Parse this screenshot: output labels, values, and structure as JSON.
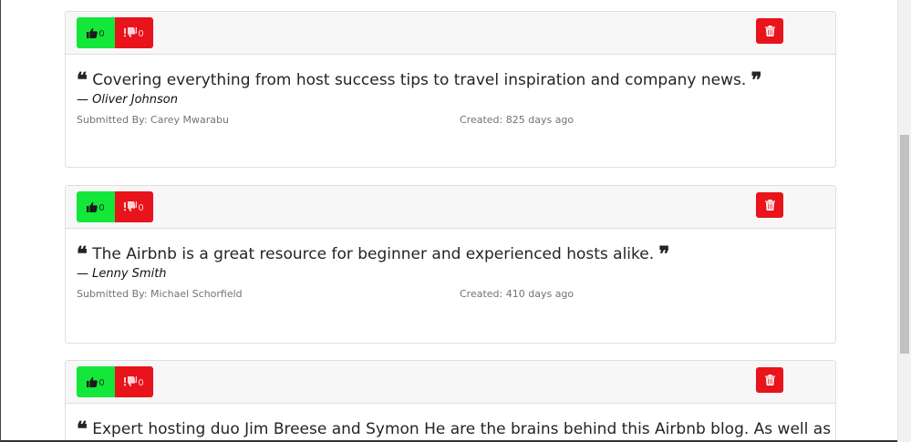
{
  "colors": {
    "upvote": "#13e83a",
    "downvote": "#e8131b",
    "delete": "#e8131b",
    "header_bg": "#f7f7f7"
  },
  "icons": {
    "upvote": "thumbs-up-icon",
    "downvote": "thumbs-down-icon",
    "delete": "trash-icon",
    "quote_open": "quote-left-icon",
    "quote_close": "quote-right-icon"
  },
  "quotes": [
    {
      "upvotes": "0",
      "downvotes": "0",
      "text": "Covering everything from host success tips to travel inspiration and company news.",
      "author": "— Oliver Johnson",
      "submitted_by": "Submitted By: Carey Mwarabu",
      "created": "Created: 825 days ago"
    },
    {
      "upvotes": "0",
      "downvotes": "0",
      "text": "The Airbnb is a great resource for beginner and experienced hosts alike.",
      "author": "— Lenny Smith",
      "submitted_by": "Submitted By: Michael Schorfield",
      "created": "Created: 410 days ago"
    },
    {
      "upvotes": "0",
      "downvotes": "0",
      "text": "Expert hosting duo Jim Breese and Symon He are the brains behind this Airbnb blog. As well as"
    }
  ]
}
